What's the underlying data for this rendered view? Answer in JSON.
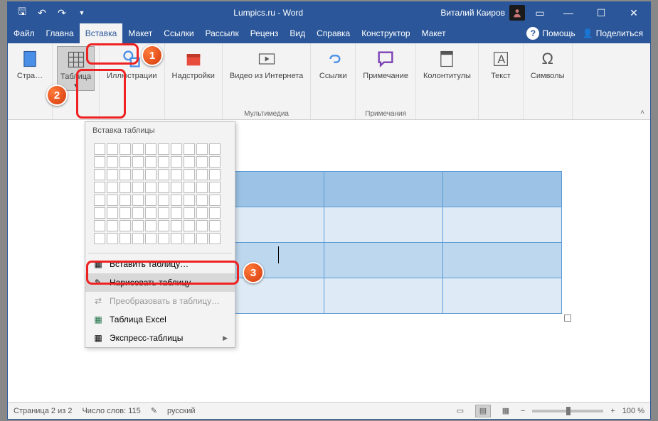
{
  "title": "Lumpics.ru  -  Word",
  "user": "Виталий Каиров",
  "tabs": [
    "Файл",
    "Главна",
    "Вставка",
    "Макет",
    "Ссылки",
    "Рассылк",
    "Реценз",
    "Вид",
    "Справка",
    "Конструктор",
    "Макет"
  ],
  "tab_help": "Помощь",
  "tab_share": "Поделиться",
  "ribbon": {
    "pages": {
      "btn": "Стра…"
    },
    "table": {
      "btn": "Таблица"
    },
    "illustrations": {
      "btn": "Иллюстрации"
    },
    "addins": {
      "btn": "Надстройки"
    },
    "media": {
      "btn": "Видео из Интернета",
      "label": "Мультимедиа"
    },
    "links": {
      "btn": "Ссылки"
    },
    "comments": {
      "btn": "Примечание",
      "label": "Примечания"
    },
    "headerfooter": {
      "btn": "Колонтитулы"
    },
    "text": {
      "btn": "Текст"
    },
    "symbols": {
      "btn": "Символы"
    }
  },
  "dropdown": {
    "header": "Вставка таблицы",
    "insert": "Вставить таблицу…",
    "draw": "Нарисовать таблицу",
    "convert": "Преобразовать в таблицу…",
    "excel": "Таблица Excel",
    "quick": "Экспресс-таблицы"
  },
  "status": {
    "page": "Страница 2 из 2",
    "words": "Число слов: 115",
    "lang": "русский",
    "zoom": "100 %"
  }
}
